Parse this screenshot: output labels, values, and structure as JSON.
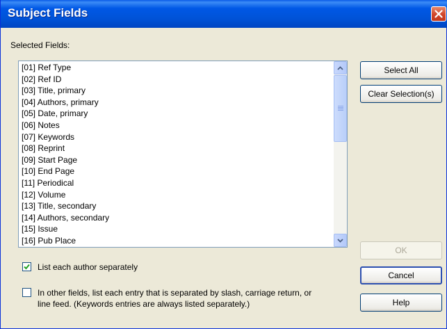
{
  "window": {
    "title": "Subject Fields"
  },
  "selected_fields_label": "Selected Fields:",
  "fields": [
    "[01] Ref Type",
    "[02] Ref ID",
    "[03] Title, primary",
    "[04] Authors, primary",
    "[05] Date, primary",
    "[06] Notes",
    "[07] Keywords",
    "[08] Reprint",
    "[09] Start Page",
    "[10] End Page",
    "[11] Periodical",
    "[12] Volume",
    "[13] Title, secondary",
    "[14] Authors, secondary",
    "[15] Issue",
    "[16] Pub Place"
  ],
  "buttons": {
    "select_all": "Select All",
    "clear_selection": "Clear Selection(s)",
    "ok": "OK",
    "cancel": "Cancel",
    "help": "Help"
  },
  "options": {
    "list_authors_separately": {
      "label": "List each author separately",
      "checked": true
    },
    "split_other_fields": {
      "line1": "In other fields, list each entry that is separated by slash, carriage return, or",
      "line2": "line feed. (Keywords entries are always listed separately.)",
      "checked": false
    }
  },
  "colors": {
    "titlebar": "#0054e3",
    "dialog_bg": "#ece9d8",
    "close_button": "#d0452a"
  },
  "icons": {
    "close": "close-icon",
    "scroll_up": "chevron-up-icon",
    "scroll_down": "chevron-down-icon",
    "check": "checkmark-icon"
  }
}
